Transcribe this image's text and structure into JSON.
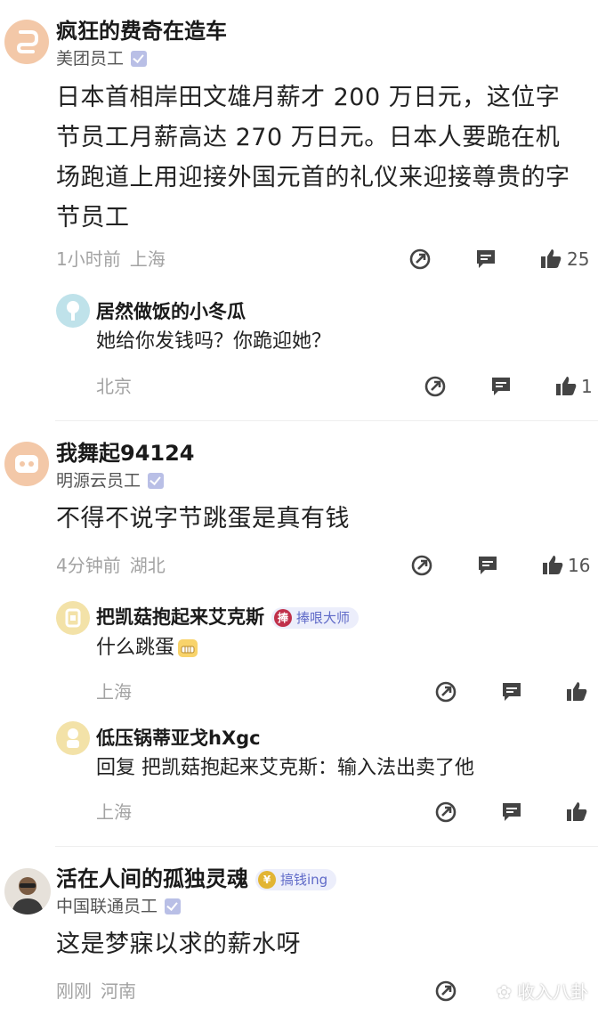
{
  "comments": [
    {
      "author": "疯狂的费奇在造车",
      "company": "美团员工",
      "text": "日本首相岸田文雄月薪才 200 万日元，这位字节员工月薪高达 270 万日元。日本人要跪在机场跑道上用迎接外国元首的礼仪来迎接尊贵的字节员工",
      "time": "1小时前",
      "location": "上海",
      "likes": "25",
      "avatar_icon": "paperclip-avatar-icon",
      "replies": [
        {
          "author": "居然做饭的小冬瓜",
          "text": "她给你发钱吗？你跪迎她？",
          "location": "北京",
          "likes": "1"
        }
      ]
    },
    {
      "author": "我舞起94124",
      "company": "明源云员工",
      "text": "不得不说字节跳蛋是真有钱",
      "time": "4分钟前",
      "location": "湖北",
      "likes": "16",
      "replies": [
        {
          "author": "把凯菇抱起来艾克斯",
          "badge": "捧哏大师",
          "badge_glyph": "捧",
          "text": "什么跳蛋",
          "location": "上海"
        },
        {
          "author": "低压锅蒂亚戈hXgc",
          "text": "回复 把凯菇抱起来艾克斯：输入法出卖了他",
          "location": "上海"
        }
      ]
    },
    {
      "author": "活在人间的孤独灵魂",
      "badge": "搞钱ing",
      "badge_glyph": "¥",
      "company": "中国联通员工",
      "text": "这是梦寐以求的薪水呀",
      "time": "刚刚",
      "location": "河南"
    }
  ],
  "watermark": "收入八卦",
  "colors": {
    "meta_gray": "#a3a3a3",
    "verify_badge": "#b9bfe6",
    "badge_bg": "#eceefb",
    "badge_text": "#5f6ac8"
  }
}
